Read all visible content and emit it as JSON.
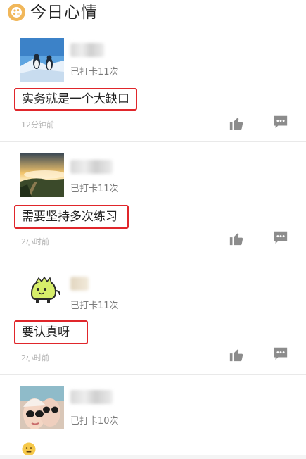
{
  "header": {
    "title": "今日心情",
    "logo_icon": "palette-icon"
  },
  "posts": [
    {
      "checkin": "已打卡11次",
      "content": "实务就是一个大缺口",
      "time": "12分钟前",
      "avatar": "penguins-on-ice-avatar"
    },
    {
      "checkin": "已打卡11次",
      "content": "需要坚持多次练习",
      "time": "2小时前",
      "avatar": "mountain-sunset-avatar"
    },
    {
      "checkin": "已打卡11次",
      "content": "要认真呀",
      "time": "2小时前",
      "avatar": "green-dinosaur-avatar"
    },
    {
      "checkin": "已打卡10次",
      "avatar": "selfie-with-sunglasses-avatar"
    }
  ],
  "icons": {
    "like": "thumbs-up-icon",
    "comment": "comment-bubble-icon",
    "emoji": "neutral-face-emoji-icon"
  },
  "colors": {
    "highlight_border": "#e0262b",
    "logo": "#f1b75a",
    "icon_gray": "#8c8c8c"
  }
}
